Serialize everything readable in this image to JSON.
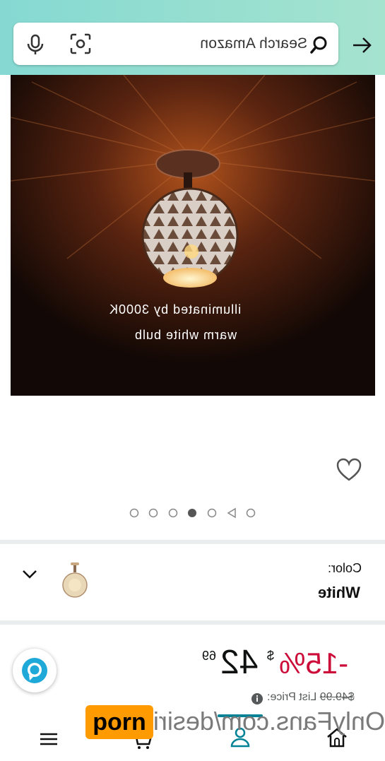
{
  "search": {
    "placeholder": "Search Amazon"
  },
  "image": {
    "caption_line1": "illuminated by 3000K",
    "caption_line2": "warm white bulb",
    "carousel_count": 7,
    "carousel_active_index": 3
  },
  "color": {
    "label": "Color:",
    "value": "White"
  },
  "price": {
    "discount": "-15%",
    "currency": "$",
    "whole": "42",
    "cents": "69",
    "list_label": "List Price:",
    "list_value": "$49.99"
  },
  "watermark": {
    "text": "OnlyFans.com/desirinukox",
    "badge": "porn"
  },
  "colors": {
    "header": "#85d9d2",
    "discount": "#cc0c39",
    "accent": "#008296",
    "badge": "#ff9a00"
  },
  "icons": [
    "search-icon",
    "mic-icon",
    "camera-scan-icon",
    "arrow-right-icon",
    "heart-icon",
    "chevron-down-icon",
    "alexa-icon",
    "menu-icon",
    "cart-icon",
    "account-icon",
    "home-icon",
    "info-icon"
  ]
}
